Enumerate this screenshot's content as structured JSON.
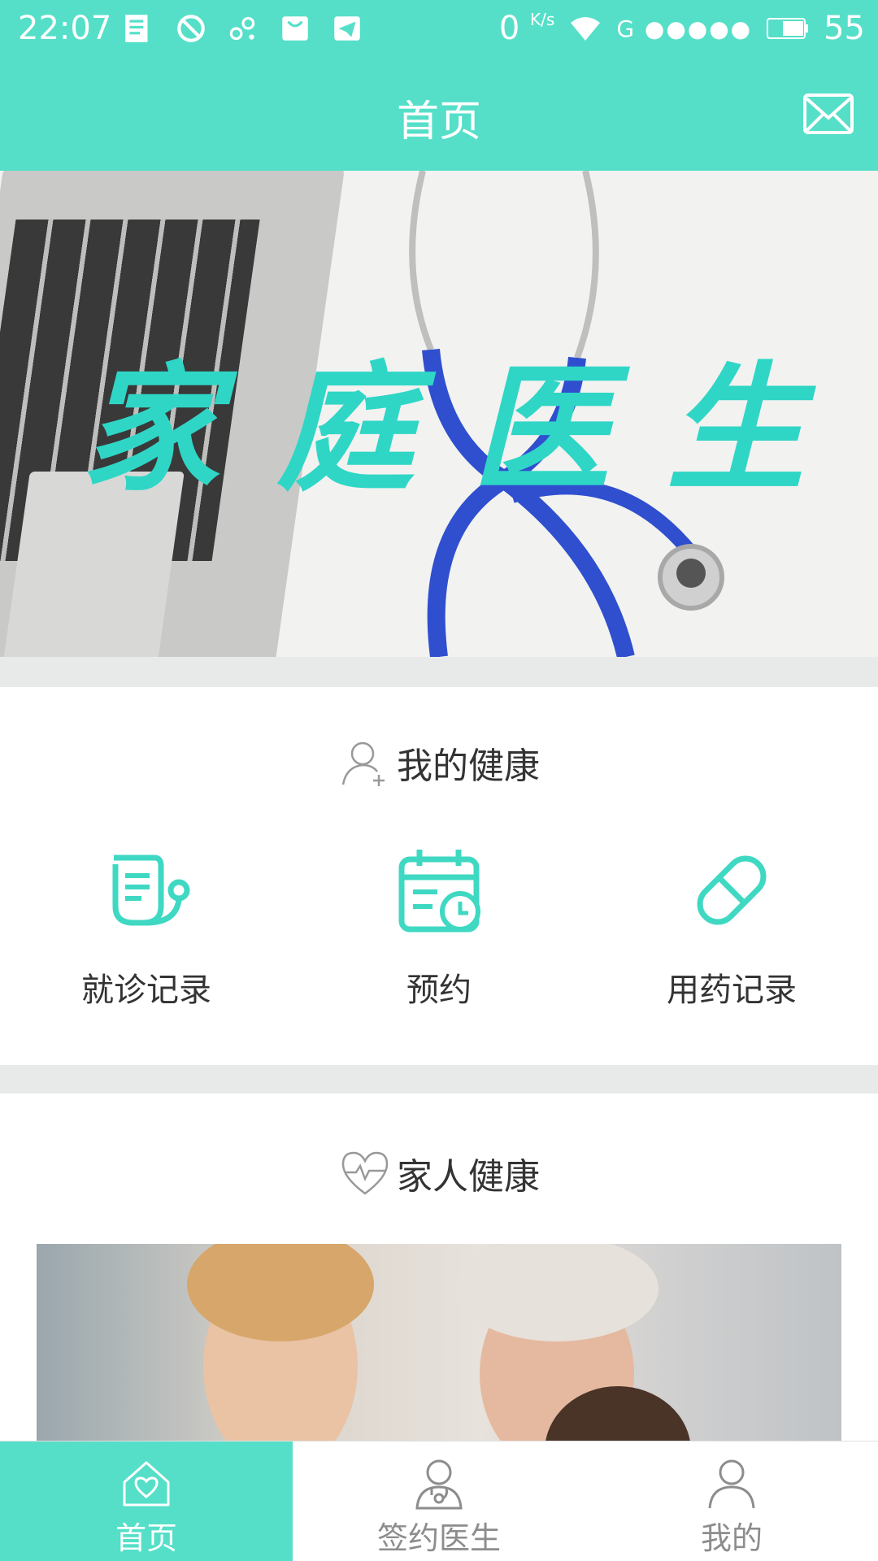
{
  "status_bar": {
    "time": "22:07",
    "net_speed_value": "0",
    "net_speed_unit": "K/s",
    "network": "G ●●●●●",
    "battery": "55",
    "left_icons": [
      "news-icon",
      "block-icon",
      "route-icon",
      "store-icon",
      "telegram-icon"
    ]
  },
  "header": {
    "title": "首页",
    "action_icon": "mail-icon"
  },
  "banner": {
    "headline_chars": [
      "家",
      "庭",
      "医",
      "生"
    ]
  },
  "my_health": {
    "title": "我的健康",
    "title_icon": "add-user-icon",
    "items": [
      {
        "label": "就诊记录",
        "icon": "stethoscope-record-icon"
      },
      {
        "label": "预约",
        "icon": "calendar-clock-icon"
      },
      {
        "label": "用药记录",
        "icon": "capsule-icon"
      }
    ]
  },
  "family_health": {
    "title": "家人健康",
    "title_icon": "heartbeat-icon"
  },
  "tabbar": {
    "tabs": [
      {
        "label": "首页",
        "icon": "home-icon",
        "active": true
      },
      {
        "label": "签约医生",
        "icon": "doctor-icon",
        "active": false
      },
      {
        "label": "我的",
        "icon": "profile-icon",
        "active": false
      }
    ]
  },
  "colors": {
    "accent": "#55dfc8",
    "icon_teal": "#3fd8c3",
    "separator": "#e8eaea"
  }
}
